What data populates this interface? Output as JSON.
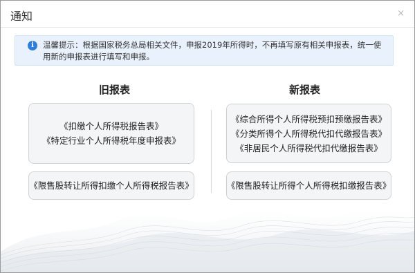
{
  "dialog": {
    "title": "通知",
    "close_label": "×"
  },
  "notice": {
    "icon": "info-icon",
    "icon_glyph": "i",
    "text": "温馨提示：根据国家税务总局相关文件，申报2019年所得时，不再填写原有相关申报表，统一使用新的申报表进行填写和申报。"
  },
  "old_forms": {
    "heading": "旧报表",
    "group1": [
      "《扣缴个人所得税报告表》",
      "《特定行业个人所得税年度申报表》"
    ],
    "group2": [
      "《限售股转让所得扣缴个人所得税报告表》"
    ]
  },
  "new_forms": {
    "heading": "新报表",
    "group1": [
      "《综合所得个人所得税预扣预缴报告表》",
      "《分类所得个人所得税代扣代缴报告表》",
      "《非居民个人所得税代扣代缴报告表》"
    ],
    "group2": [
      "《限售股转让所得个人所得税扣缴报告表》"
    ]
  }
}
